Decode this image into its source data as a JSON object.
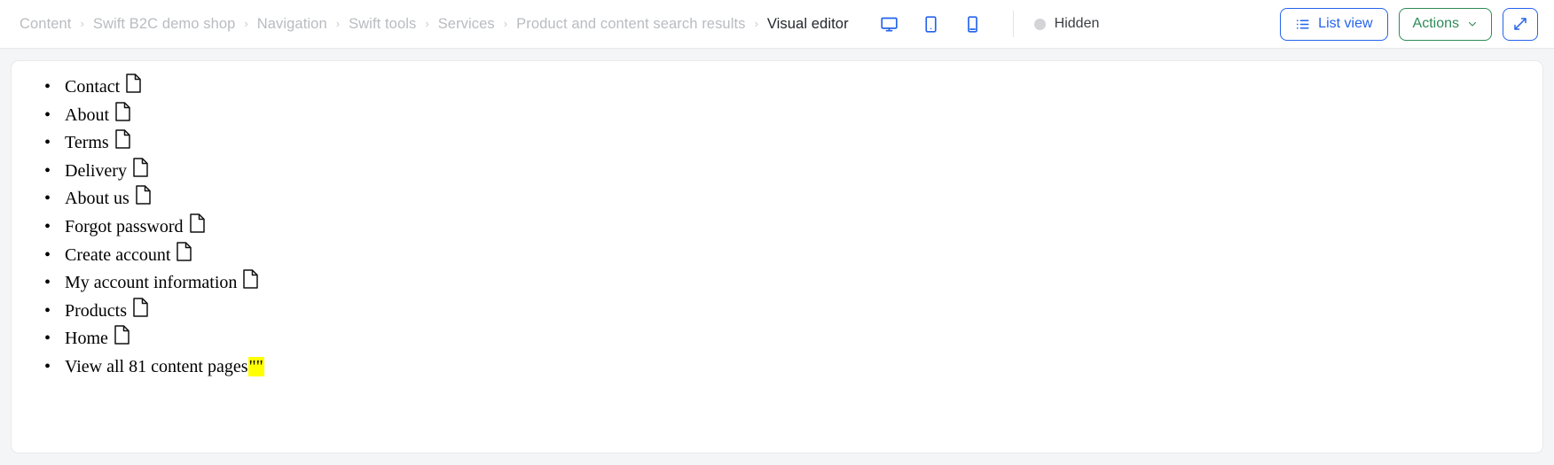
{
  "topbar": {
    "breadcrumb": [
      {
        "label": "Content",
        "active": false
      },
      {
        "label": "Swift B2C demo shop",
        "active": false
      },
      {
        "label": "Navigation",
        "active": false
      },
      {
        "label": "Swift tools",
        "active": false
      },
      {
        "label": "Services",
        "active": false
      },
      {
        "label": "Product and content search results",
        "active": false
      },
      {
        "label": "Visual editor",
        "active": true
      }
    ],
    "separator": "›",
    "devices": [
      {
        "name": "desktop-view",
        "icon": "desktop-icon"
      },
      {
        "name": "tablet-view",
        "icon": "tablet-icon"
      },
      {
        "name": "mobile-view",
        "icon": "mobile-icon"
      }
    ],
    "status": {
      "label": "Hidden",
      "dot_color": "#d2d4d7"
    },
    "buttons": {
      "list_view": {
        "label": "List view",
        "icon": "list-icon",
        "color": "#2563eb"
      },
      "actions": {
        "label": "Actions",
        "chevron": "⌄",
        "color": "#2e8b57"
      },
      "expand": {
        "label": "",
        "icon": "expand-arrows-icon",
        "color": "#2563eb"
      }
    }
  },
  "main": {
    "items": [
      {
        "label": "Contact",
        "icon": "page-icon"
      },
      {
        "label": "About",
        "icon": "page-icon"
      },
      {
        "label": "Terms",
        "icon": "page-icon"
      },
      {
        "label": "Delivery",
        "icon": "page-icon"
      },
      {
        "label": "About us",
        "icon": "page-icon"
      },
      {
        "label": "Forgot password",
        "icon": "page-icon"
      },
      {
        "label": "Create account",
        "icon": "page-icon"
      },
      {
        "label": "My account information",
        "icon": "page-icon"
      },
      {
        "label": "Products",
        "icon": "page-icon"
      },
      {
        "label": "Home",
        "icon": "page-icon"
      }
    ],
    "view_all": {
      "label": "View all 81 content pages",
      "highlighted_text": "\"\"",
      "highlight_color": "#ffff00",
      "count": 81
    }
  }
}
